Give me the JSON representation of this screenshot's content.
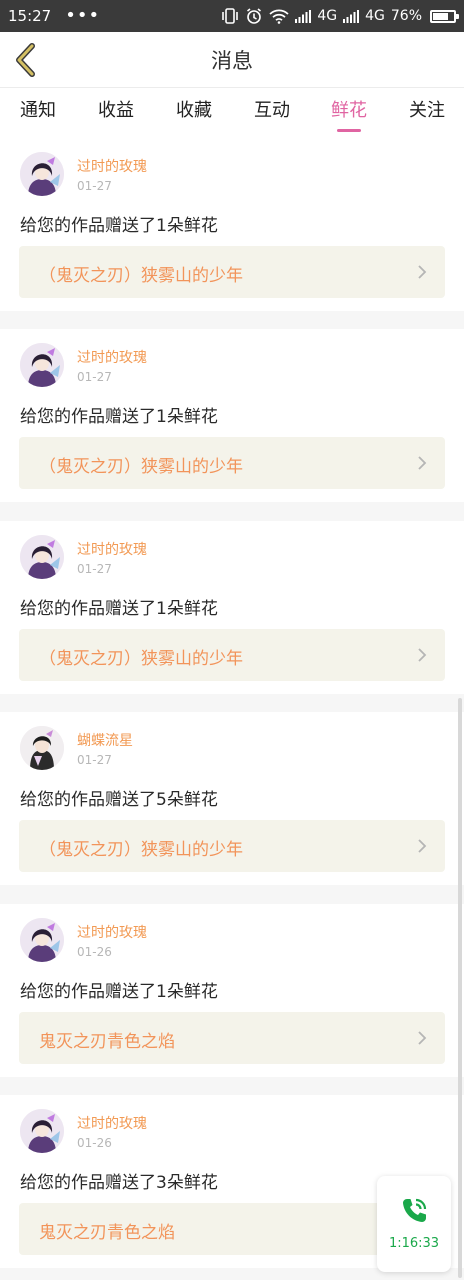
{
  "status_bar": {
    "time": "15:27",
    "dots": "•••",
    "network1": "4G",
    "network2": "4G",
    "battery": "76%",
    "battery_level": 0.76
  },
  "header": {
    "title": "消息"
  },
  "tabs": [
    {
      "label": "通知",
      "active": false
    },
    {
      "label": "收益",
      "active": false
    },
    {
      "label": "收藏",
      "active": false
    },
    {
      "label": "互动",
      "active": false
    },
    {
      "label": "鲜花",
      "active": true
    },
    {
      "label": "关注",
      "active": false
    }
  ],
  "messages": [
    {
      "user": "过时的玫瑰",
      "date": "01-27",
      "text": "给您的作品赠送了1朵鲜花",
      "work": "（鬼灭之刃）狭雾山的少年"
    },
    {
      "user": "过时的玫瑰",
      "date": "01-27",
      "text": "给您的作品赠送了1朵鲜花",
      "work": "（鬼灭之刃）狭雾山的少年"
    },
    {
      "user": "过时的玫瑰",
      "date": "01-27",
      "text": "给您的作品赠送了1朵鲜花",
      "work": "（鬼灭之刃）狭雾山的少年"
    },
    {
      "user": "蝴蝶流星",
      "date": "01-27",
      "text": "给您的作品赠送了5朵鲜花",
      "work": "（鬼灭之刃）狭雾山的少年"
    },
    {
      "user": "过时的玫瑰",
      "date": "01-26",
      "text": "给您的作品赠送了1朵鲜花",
      "work": "鬼灭之刃青色之焰"
    },
    {
      "user": "过时的玫瑰",
      "date": "01-26",
      "text": "给您的作品赠送了3朵鲜花",
      "work": "鬼灭之刃青色之焰"
    }
  ],
  "call_widget": {
    "duration": "1:16:33"
  },
  "colors": {
    "accent": "#e064a2",
    "username": "#f29a54",
    "work_title": "#f2945a",
    "back_arrow": "#b59a2c",
    "call_green": "#1aa84a"
  }
}
